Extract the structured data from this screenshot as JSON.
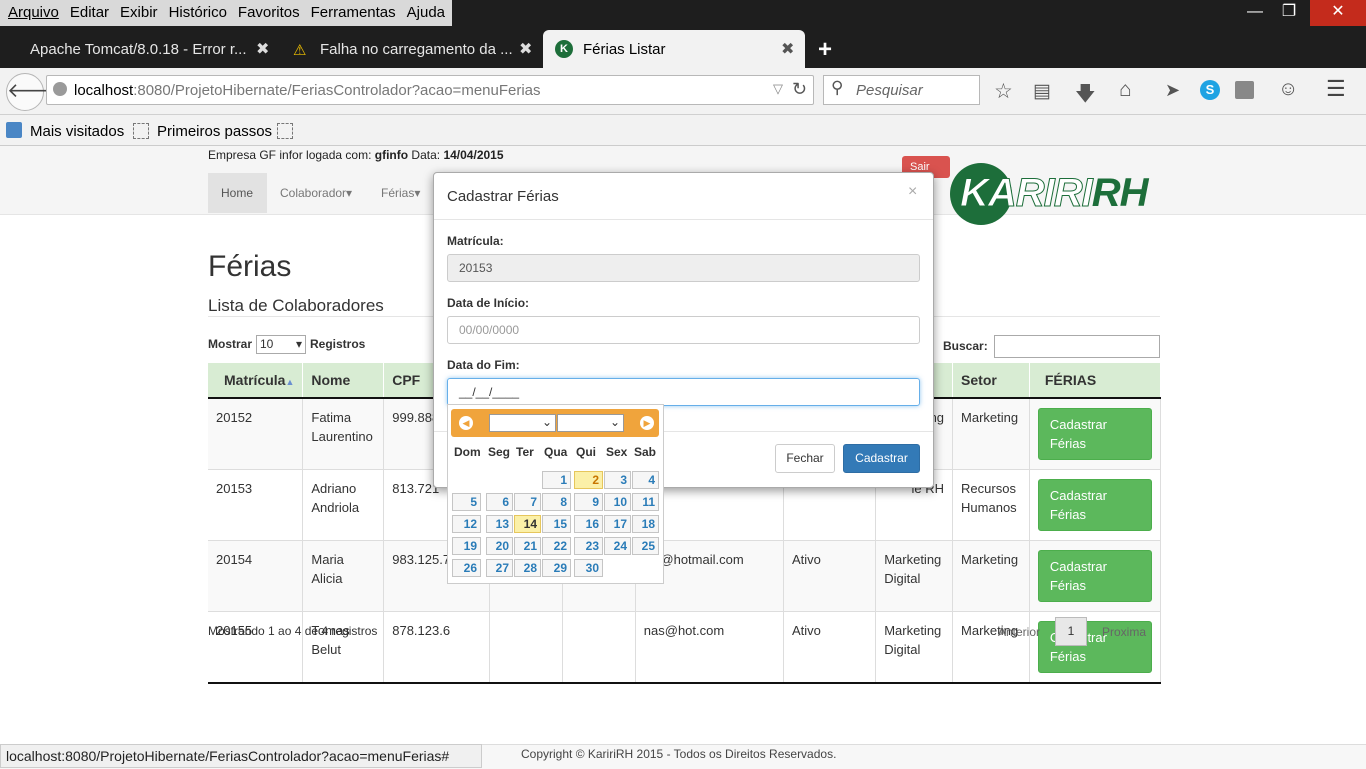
{
  "menubar": {
    "items": [
      "Arquivo",
      "Editar",
      "Exibir",
      "Histórico",
      "Favoritos",
      "Ferramentas",
      "Ajuda"
    ]
  },
  "tabs": [
    {
      "title": "Apache Tomcat/8.0.18 - Error r..."
    },
    {
      "title": "Falha no carregamento da ..."
    },
    {
      "title": "Férias Listar"
    }
  ],
  "address": {
    "host": "localhost",
    "path": ":8080/ProjetoHibernate/FeriasControlador?acao=menuFerias"
  },
  "search": {
    "placeholder": "Pesquisar"
  },
  "bookmarks": [
    "Mais visitados",
    "Primeiros passos"
  ],
  "site": {
    "login_prefix": "Empresa GF infor logada com:",
    "user": "gfinfo",
    "date_prefix": "Data:",
    "date": "14/04/2015",
    "logout": "Sair",
    "nav": [
      "Home",
      "Colaborador",
      "Férias"
    ],
    "logo_text_1": "KARIRI",
    "logo_text_2": "RH"
  },
  "main": {
    "title": "Férias",
    "subtitle": "Lista de Colaboradores",
    "show_label": "Mostrar",
    "page_size": "10",
    "records_label": "Registros",
    "search_label": "Buscar:",
    "columns": [
      "Matrícula",
      "Nome",
      "CPF",
      "",
      "",
      "",
      "",
      "Setor",
      "FÉRIAS"
    ],
    "rows": [
      {
        "matricula": "20152",
        "nome": "Fatima Laurentino",
        "cpf": "999.888",
        "email": "",
        "status": "",
        "area": "ng",
        "setor": "Marketing"
      },
      {
        "matricula": "20153",
        "nome": "Adriano Andriola",
        "cpf": "813.721",
        "email": "",
        "status": "",
        "area": "le RH",
        "setor": "Recursos Humanos"
      },
      {
        "matricula": "20154",
        "nome": "Maria Alicia",
        "cpf": "983.125.7",
        "email": "cia@hotmail.com",
        "status": "Ativo",
        "area": "Marketing Digital",
        "setor": "Marketing"
      },
      {
        "matricula": "20155",
        "nome": "Tomas Belut",
        "cpf": "878.123.6",
        "email": "nas@hot.com",
        "status": "Ativo",
        "area": "Marketing Digital",
        "setor": "Marketing"
      }
    ],
    "row_button": "Cadastrar Férias",
    "info": "Mostrando 1 ao 4 de 4 registros",
    "prev": "Anterior",
    "page": "1",
    "next": "Proxima"
  },
  "modal": {
    "title": "Cadastrar Férias",
    "matricula_label": "Matrícula:",
    "matricula_value": "20153",
    "inicio_label": "Data de Início:",
    "inicio_placeholder": "00/00/0000",
    "fim_label": "Data do Fim:",
    "fim_value": "__/__/____",
    "close": "Fechar",
    "submit": "Cadastrar"
  },
  "datepicker": {
    "weekdays": [
      "Dom",
      "Seg",
      "Ter",
      "Qua",
      "Qui",
      "Sex",
      "Sab"
    ],
    "first_weekday": 3,
    "days": 30,
    "today": 14,
    "selected": 2
  },
  "statusbar": {
    "url": "localhost:8080/ProjetoHibernate/FeriasControlador?acao=menuFerias#"
  },
  "footer": {
    "text": "Copyright © KaririRH 2015 - Todos os Direitos Reservados."
  }
}
